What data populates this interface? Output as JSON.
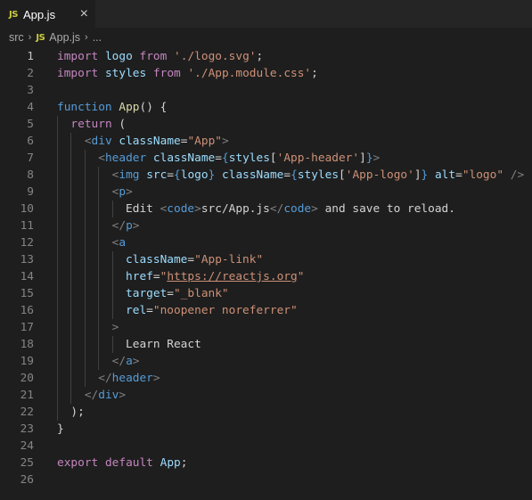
{
  "tab": {
    "badge": "JS",
    "title": "App.js",
    "close": "×"
  },
  "breadcrumb": {
    "folder": "src",
    "sep": "›",
    "badge": "JS",
    "file": "App.js",
    "more": "..."
  },
  "colors": {
    "keyword": "#569cd6",
    "control": "#c586c0",
    "string": "#ce9178",
    "variable": "#9cdcfe",
    "function": "#dcdcaa",
    "text": "#d4d4d4"
  },
  "active_line": 1,
  "lines": [
    {
      "n": "1",
      "indent": 0,
      "tokens": [
        [
          "kc",
          "import"
        ],
        [
          "txt",
          " "
        ],
        [
          "var",
          "logo"
        ],
        [
          "txt",
          " "
        ],
        [
          "kc",
          "from"
        ],
        [
          "txt",
          " "
        ],
        [
          "str",
          "'./logo.svg'"
        ],
        [
          "txt",
          ";"
        ]
      ]
    },
    {
      "n": "2",
      "indent": 0,
      "tokens": [
        [
          "kc",
          "import"
        ],
        [
          "txt",
          " "
        ],
        [
          "var",
          "styles"
        ],
        [
          "txt",
          " "
        ],
        [
          "kc",
          "from"
        ],
        [
          "txt",
          " "
        ],
        [
          "str",
          "'./App.module.css'"
        ],
        [
          "txt",
          ";"
        ]
      ]
    },
    {
      "n": "3",
      "indent": 0,
      "tokens": []
    },
    {
      "n": "4",
      "indent": 0,
      "tokens": [
        [
          "kw",
          "function"
        ],
        [
          "txt",
          " "
        ],
        [
          "fn",
          "App"
        ],
        [
          "txt",
          "() {"
        ]
      ]
    },
    {
      "n": "5",
      "indent": 1,
      "tokens": [
        [
          "kc",
          "return"
        ],
        [
          "txt",
          " ("
        ]
      ]
    },
    {
      "n": "6",
      "indent": 2,
      "tokens": [
        [
          "pun",
          "<"
        ],
        [
          "tag",
          "div"
        ],
        [
          "txt",
          " "
        ],
        [
          "var",
          "className"
        ],
        [
          "txt",
          "="
        ],
        [
          "str",
          "\"App\""
        ],
        [
          "pun",
          ">"
        ]
      ]
    },
    {
      "n": "7",
      "indent": 3,
      "tokens": [
        [
          "pun",
          "<"
        ],
        [
          "tag",
          "header"
        ],
        [
          "txt",
          " "
        ],
        [
          "var",
          "className"
        ],
        [
          "txt",
          "="
        ],
        [
          "kw",
          "{"
        ],
        [
          "var",
          "styles"
        ],
        [
          "txt",
          "["
        ],
        [
          "str",
          "'App-header'"
        ],
        [
          "txt",
          "]"
        ],
        [
          "kw",
          "}"
        ],
        [
          "pun",
          ">"
        ]
      ]
    },
    {
      "n": "8",
      "indent": 4,
      "tokens": [
        [
          "pun",
          "<"
        ],
        [
          "tag",
          "img"
        ],
        [
          "txt",
          " "
        ],
        [
          "var",
          "src"
        ],
        [
          "txt",
          "="
        ],
        [
          "kw",
          "{"
        ],
        [
          "var",
          "logo"
        ],
        [
          "kw",
          "}"
        ],
        [
          "txt",
          " "
        ],
        [
          "var",
          "className"
        ],
        [
          "txt",
          "="
        ],
        [
          "kw",
          "{"
        ],
        [
          "var",
          "styles"
        ],
        [
          "txt",
          "["
        ],
        [
          "str",
          "'App-logo'"
        ],
        [
          "txt",
          "]"
        ],
        [
          "kw",
          "}"
        ],
        [
          "txt",
          " "
        ],
        [
          "var",
          "alt"
        ],
        [
          "txt",
          "="
        ],
        [
          "str",
          "\"logo\""
        ],
        [
          "txt",
          " "
        ],
        [
          "pun",
          "/>"
        ]
      ]
    },
    {
      "n": "9",
      "indent": 4,
      "tokens": [
        [
          "pun",
          "<"
        ],
        [
          "tag",
          "p"
        ],
        [
          "pun",
          ">"
        ]
      ]
    },
    {
      "n": "10",
      "indent": 5,
      "tokens": [
        [
          "txt",
          "Edit "
        ],
        [
          "pun",
          "<"
        ],
        [
          "tag",
          "code"
        ],
        [
          "pun",
          ">"
        ],
        [
          "txt",
          "src/App.js"
        ],
        [
          "pun",
          "</"
        ],
        [
          "tag",
          "code"
        ],
        [
          "pun",
          ">"
        ],
        [
          "txt",
          " and save to reload."
        ]
      ]
    },
    {
      "n": "11",
      "indent": 4,
      "tokens": [
        [
          "pun",
          "</"
        ],
        [
          "tag",
          "p"
        ],
        [
          "pun",
          ">"
        ]
      ]
    },
    {
      "n": "12",
      "indent": 4,
      "tokens": [
        [
          "pun",
          "<"
        ],
        [
          "tag",
          "a"
        ]
      ]
    },
    {
      "n": "13",
      "indent": 5,
      "tokens": [
        [
          "var",
          "className"
        ],
        [
          "txt",
          "="
        ],
        [
          "str",
          "\"App-link\""
        ]
      ]
    },
    {
      "n": "14",
      "indent": 5,
      "tokens": [
        [
          "var",
          "href"
        ],
        [
          "txt",
          "="
        ],
        [
          "str",
          "\""
        ],
        [
          "link",
          "https://reactjs.org"
        ],
        [
          "str",
          "\""
        ]
      ]
    },
    {
      "n": "15",
      "indent": 5,
      "tokens": [
        [
          "var",
          "target"
        ],
        [
          "txt",
          "="
        ],
        [
          "str",
          "\"_blank\""
        ]
      ]
    },
    {
      "n": "16",
      "indent": 5,
      "tokens": [
        [
          "var",
          "rel"
        ],
        [
          "txt",
          "="
        ],
        [
          "str",
          "\"noopener noreferrer\""
        ]
      ]
    },
    {
      "n": "17",
      "indent": 4,
      "tokens": [
        [
          "pun",
          ">"
        ]
      ]
    },
    {
      "n": "18",
      "indent": 5,
      "tokens": [
        [
          "txt",
          "Learn React"
        ]
      ]
    },
    {
      "n": "19",
      "indent": 4,
      "tokens": [
        [
          "pun",
          "</"
        ],
        [
          "tag",
          "a"
        ],
        [
          "pun",
          ">"
        ]
      ]
    },
    {
      "n": "20",
      "indent": 3,
      "tokens": [
        [
          "pun",
          "</"
        ],
        [
          "tag",
          "header"
        ],
        [
          "pun",
          ">"
        ]
      ]
    },
    {
      "n": "21",
      "indent": 2,
      "tokens": [
        [
          "pun",
          "</"
        ],
        [
          "tag",
          "div"
        ],
        [
          "pun",
          ">"
        ]
      ]
    },
    {
      "n": "22",
      "indent": 1,
      "tokens": [
        [
          "txt",
          ");"
        ]
      ]
    },
    {
      "n": "23",
      "indent": 0,
      "tokens": [
        [
          "txt",
          "}"
        ]
      ]
    },
    {
      "n": "24",
      "indent": 0,
      "tokens": []
    },
    {
      "n": "25",
      "indent": 0,
      "tokens": [
        [
          "kc",
          "export"
        ],
        [
          "txt",
          " "
        ],
        [
          "kc",
          "default"
        ],
        [
          "txt",
          " "
        ],
        [
          "var",
          "App"
        ],
        [
          "txt",
          ";"
        ]
      ]
    },
    {
      "n": "26",
      "indent": 0,
      "tokens": []
    }
  ]
}
